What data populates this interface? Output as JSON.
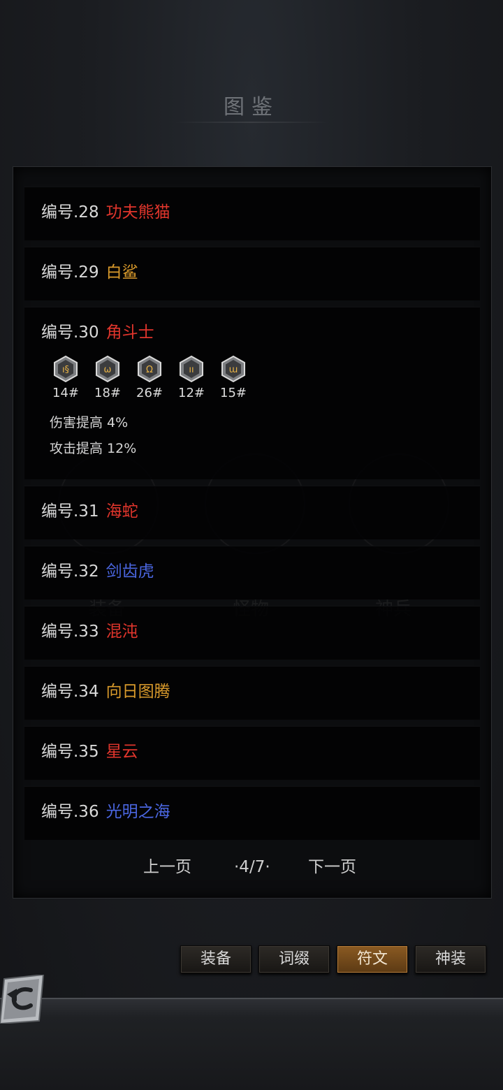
{
  "header": {
    "title": "图鉴"
  },
  "ghost_labels": [
    "装备",
    "怪物",
    "神兵"
  ],
  "entries": [
    {
      "number": "编号.28",
      "name": "功夫熊猫",
      "color": "#e0352c"
    },
    {
      "number": "编号.29",
      "name": "白鲨",
      "color": "#d99a2b"
    },
    {
      "number": "编号.30",
      "name": "角斗士",
      "color": "#e0352c",
      "runes": [
        {
          "label": "14#",
          "glyph": "ı§"
        },
        {
          "label": "18#",
          "glyph": "ω"
        },
        {
          "label": "26#",
          "glyph": "Ω"
        },
        {
          "label": "12#",
          "glyph": "ıı"
        },
        {
          "label": "15#",
          "glyph": "ɯ"
        }
      ],
      "bonuses": [
        "伤害提高 4%",
        "攻击提高 12%"
      ]
    },
    {
      "number": "编号.31",
      "name": "海蛇",
      "color": "#e0352c"
    },
    {
      "number": "编号.32",
      "name": "剑齿虎",
      "color": "#4a66e0"
    },
    {
      "number": "编号.33",
      "name": "混沌",
      "color": "#e0352c"
    },
    {
      "number": "编号.34",
      "name": "向日图腾",
      "color": "#d99a2b"
    },
    {
      "number": "编号.35",
      "name": "星云",
      "color": "#e0352c"
    },
    {
      "number": "编号.36",
      "name": "光明之海",
      "color": "#4a66e0"
    }
  ],
  "pagination": {
    "prev_label": "上一页",
    "page_indicator": "·4/7·",
    "next_label": "下一页"
  },
  "tabs": [
    {
      "label": "装备",
      "active": false
    },
    {
      "label": "词缀",
      "active": false
    },
    {
      "label": "符文",
      "active": true
    },
    {
      "label": "神装",
      "active": false
    }
  ],
  "back_icon": "back-arrow-icon",
  "colors": {
    "accent_tab": "#8a5a22",
    "red_name": "#e0352c",
    "gold_name": "#d99a2b",
    "blue_name": "#4a66e0"
  }
}
